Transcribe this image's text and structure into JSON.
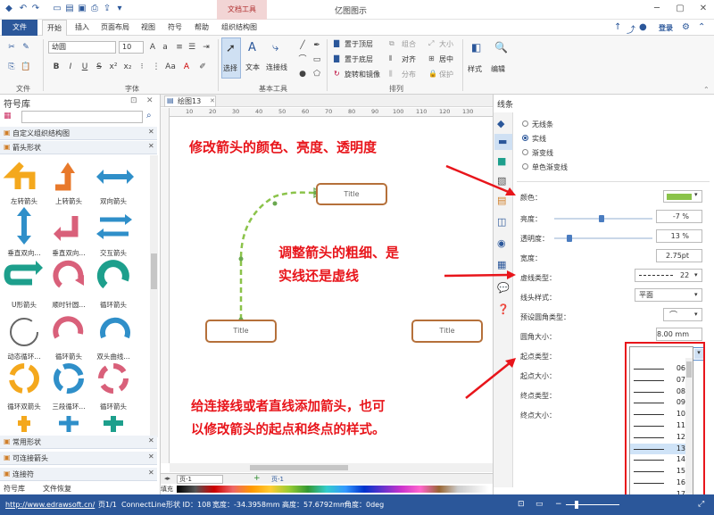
{
  "app": {
    "title": "亿图图示",
    "context_tab": "文档工具",
    "login": "登录"
  },
  "menu": {
    "file": "文件",
    "tabs": [
      "开始",
      "插入",
      "页面布局",
      "视图",
      "符号",
      "帮助",
      "组织结构图"
    ]
  },
  "ribbon": {
    "font_name": "幼圆",
    "font_size": "10",
    "select": "选择",
    "text": "文本",
    "connector": "连接线",
    "bring_front": "置于顶层",
    "send_back": "置于底层",
    "rotate_mirror": "旋转和镜像",
    "group": "组合",
    "align": "对齐",
    "distribute": "分布",
    "size": "大小",
    "center": "居中",
    "protect": "保护",
    "style": "样式",
    "edit": "编辑",
    "groups": [
      "文件",
      "字体",
      "基本工具",
      "排列"
    ]
  },
  "left_panel": {
    "title": "符号库",
    "libs_top": [
      "自定义组织结构图",
      "箭头形状"
    ],
    "shapes": [
      "左转箭头",
      "上转箭头",
      "双向箭头",
      "垂直双向...",
      "垂直双向...",
      "交互箭头",
      "U形箭头",
      "顺时针圆...",
      "循环箭头",
      "动态循环...",
      "循环箭头",
      "双头曲线...",
      "循环双箭头",
      "三段循环...",
      "循环箭头"
    ],
    "libs_bottom": [
      "常用形状",
      "可连接箭头",
      "连接符"
    ],
    "bottom_tabs": [
      "符号库",
      "文件恢复"
    ]
  },
  "canvas": {
    "doc_tab": "绘图13",
    "ruler": [
      "10",
      "20",
      "30",
      "40",
      "50",
      "60",
      "70",
      "80",
      "90",
      "100",
      "110",
      "120",
      "130"
    ],
    "node_title": "Title",
    "page_tab": "页-1",
    "page_tab2": "页-1",
    "fill_label": "填充"
  },
  "right_panel": {
    "title": "线条",
    "line_types": [
      "无线条",
      "实线",
      "渐变线",
      "单色渐变线"
    ],
    "color_label": "颜色：",
    "color_value": "#8bc34a",
    "brightness_label": "亮度：",
    "brightness_value": "-7 %",
    "brightness_level": 0.46,
    "transparency_label": "透明度：",
    "transparency_value": "13 %",
    "transparency_level": 0.13,
    "width_label": "宽度：",
    "width_value": "2.75pt",
    "dash_label": "虚线类型：",
    "dash_value": "22",
    "cap_label": "线头样式：",
    "cap_value": "平面",
    "corner_label": "预设圆角类型：",
    "radius_label": "圆角大小：",
    "radius_value": "8.00 mm",
    "start_type_label": "起点类型：",
    "start_type_value": "13",
    "start_size_label": "起点大小：",
    "end_type_label": "终点类型：",
    "end_size_label": "终点大小："
  },
  "dropdown_options": [
    "06",
    "07",
    "08",
    "09",
    "10",
    "11",
    "12",
    "13",
    "14",
    "15",
    "16",
    "17",
    "18"
  ],
  "dropdown_selected": "13",
  "annotations": {
    "a1": "修改箭头的颜色、亮度、透明度",
    "a2_l1": "调整箭头的粗细、是",
    "a2_l2": "实线还是虚线",
    "a3_l1": "给连接线或者直线添加箭头，也可",
    "a3_l2": "以修改箭头的起点和终点的样式。"
  },
  "status": {
    "url": "http://www.edrawsoft.cn/",
    "page": "页1/1",
    "shape_type": "ConnectLine",
    "shape_id": "形状 ID：108",
    "width": "宽度：-34.3958mm",
    "height": "高度：57.6792mm",
    "angle": "角度：0deg"
  }
}
